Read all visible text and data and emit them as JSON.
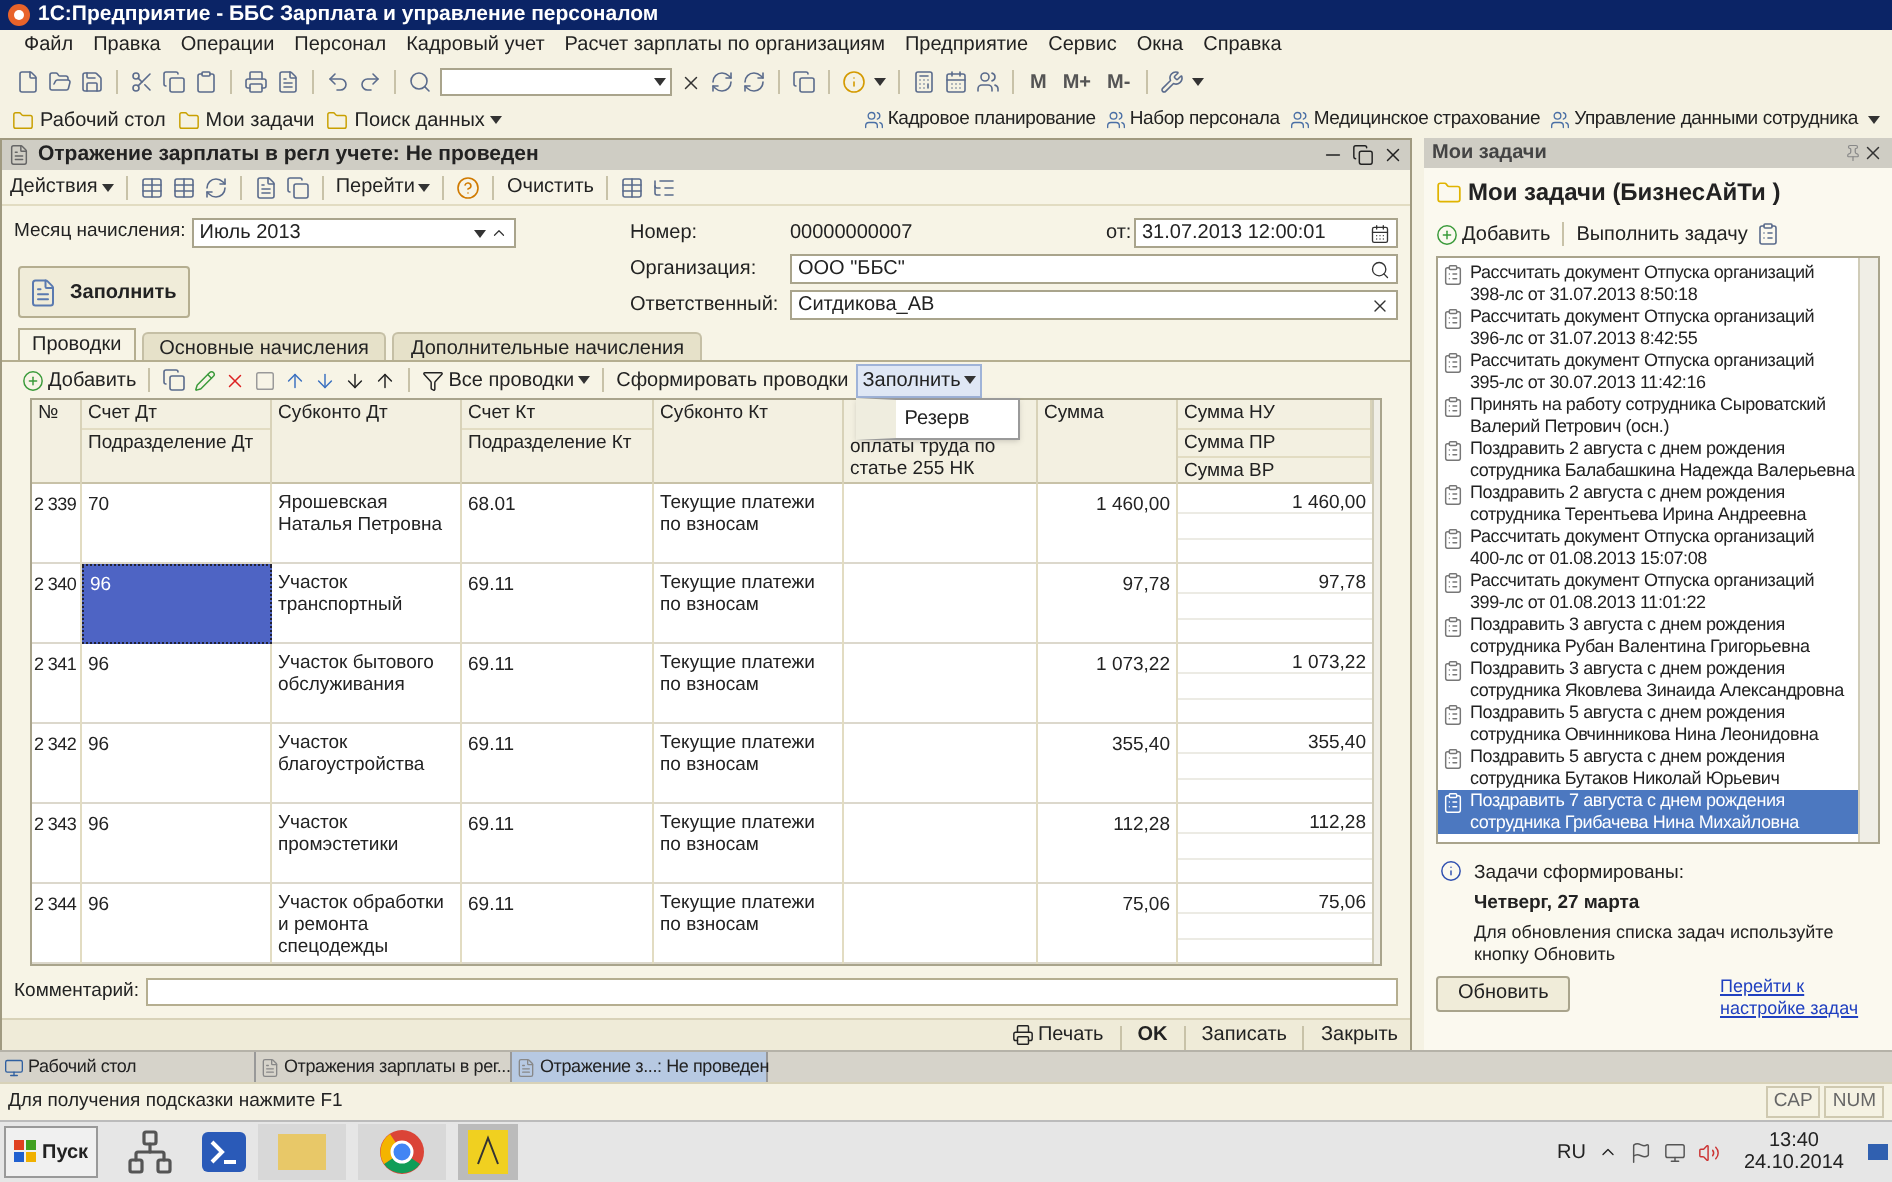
{
  "title_bar": {
    "title": "1С:Предприятие - ББС Зарплата и управление персоналом"
  },
  "menu": [
    "Файл",
    "Правка",
    "Операции",
    "Персонал",
    "Кадровый учет",
    "Расчет зарплаты по организациям",
    "Предприятие",
    "Сервис",
    "Окна",
    "Справка"
  ],
  "toolbar": {
    "memory_buttons": [
      "M",
      "M+",
      "M-"
    ]
  },
  "panel_bar": {
    "left": [
      "Рабочий стол",
      "Мои задачи",
      "Поиск данных"
    ],
    "right": [
      "Кадровое планирование",
      "Набор персонала",
      "Медицинское страхование",
      "Управление данными сотрудника"
    ]
  },
  "document": {
    "title": "Отражение зарплаты в регл учете: Не проведен",
    "toolbar": {
      "actions": "Действия",
      "goto": "Перейти",
      "clear": "Очистить"
    },
    "month_label": "Месяц начисления:",
    "month_value": "Июль 2013",
    "number_label": "Номер:",
    "number_value": "00000000007",
    "date_label": "от:",
    "date_value": "31.07.2013 12:00:01",
    "org_label": "Организация:",
    "org_value": "ООО \"ББС\"",
    "resp_label": "Ответственный:",
    "resp_value": "Ситдикова_АВ",
    "fill_button": "Заполнить",
    "tabs": [
      {
        "label": "Проводки",
        "selected": true
      },
      {
        "label": "Основные начисления",
        "selected": false
      },
      {
        "label": "Дополнительные начисления",
        "selected": false
      }
    ],
    "table_toolbar": {
      "add": "Добавить",
      "all": "Все проводки",
      "form": "Сформировать проводки",
      "fill": "Заполнить",
      "fill_open": true
    },
    "dropdown": {
      "items": [
        "Резерв"
      ]
    },
    "table": {
      "columns": [
        {
          "lines": [
            "№"
          ]
        },
        {
          "lines": [
            "Счет Дт",
            "Подразделение Дт"
          ]
        },
        {
          "lines": [
            "Субконто Дт"
          ]
        },
        {
          "lines": [
            "Счет Кт",
            "Подразделение Кт"
          ]
        },
        {
          "lines": [
            "Субконто Кт"
          ]
        },
        {
          "lines": [
            "оплаты труда по статье 255 НК"
          ]
        },
        {
          "lines": [
            "Сумма"
          ]
        },
        {
          "lines": [
            "Сумма НУ",
            "Сумма ПР",
            "Сумма ВР"
          ]
        }
      ],
      "rows": [
        {
          "no": "2 339",
          "dt": "70",
          "dt_selected": false,
          "sub_dt": "Ярошевская Наталья Петровна",
          "kt": "68.01",
          "sub_kt": "Текущие платежи по взносам",
          "summa": "1 460,00",
          "summa_nu": "1 460,00"
        },
        {
          "no": "2 340",
          "dt": "96",
          "dt_selected": true,
          "sub_dt": "Участок транспортный",
          "kt": "69.11",
          "sub_kt": "Текущие платежи по взносам",
          "summa": "97,78",
          "summa_nu": "97,78"
        },
        {
          "no": "2 341",
          "dt": "96",
          "dt_selected": false,
          "sub_dt": "Участок бытового обслуживания",
          "kt": "69.11",
          "sub_kt": "Текущие платежи по взносам",
          "summa": "1 073,22",
          "summa_nu": "1 073,22"
        },
        {
          "no": "2 342",
          "dt": "96",
          "dt_selected": false,
          "sub_dt": "Участок благоустройства",
          "kt": "69.11",
          "sub_kt": "Текущие платежи по взносам",
          "summa": "355,40",
          "summa_nu": "355,40"
        },
        {
          "no": "2 343",
          "dt": "96",
          "dt_selected": false,
          "sub_dt": "Участок промэстетики",
          "kt": "69.11",
          "sub_kt": "Текущие платежи по взносам",
          "summa": "112,28",
          "summa_nu": "112,28"
        },
        {
          "no": "2 344",
          "dt": "96",
          "dt_selected": false,
          "sub_dt": "Участок обработки и ремонта спецодежды",
          "kt": "69.11",
          "sub_kt": "Текущие платежи по взносам",
          "summa": "75,06",
          "summa_nu": "75,06"
        }
      ]
    },
    "comment_label": "Комментарий:",
    "buttons": {
      "print": "Печать",
      "ok": "OK",
      "save": "Записать",
      "close": "Закрыть"
    }
  },
  "tasks_panel": {
    "title": "Мои задачи",
    "heading": "Мои задачи (БизнесАйТи )",
    "add": "Добавить",
    "execute": "Выполнить задачу",
    "tasks": [
      {
        "lines": [
          "Рассчитать документ Отпуска организаций",
          "398-лс от 31.07.2013 8:50:18"
        ],
        "selected": false
      },
      {
        "lines": [
          "Рассчитать документ Отпуска организаций",
          "396-лс от 31.07.2013 8:42:55"
        ],
        "selected": false
      },
      {
        "lines": [
          "Рассчитать документ Отпуска организаций",
          "395-лс от 30.07.2013 11:42:16"
        ],
        "selected": false
      },
      {
        "lines": [
          "Принять на работу сотрудника Сыроватский",
          "Валерий Петрович  (осн.)"
        ],
        "selected": false
      },
      {
        "lines": [
          "Поздравить 2 августа с днем рождения",
          "сотрудника Балабашкина Надежда Валерьевна"
        ],
        "selected": false
      },
      {
        "lines": [
          "Поздравить 2 августа с днем рождения",
          "сотрудника Терентьева Ирина Андреевна"
        ],
        "selected": false
      },
      {
        "lines": [
          "Рассчитать документ Отпуска организаций",
          "400-лс от 01.08.2013 15:07:08"
        ],
        "selected": false
      },
      {
        "lines": [
          "Рассчитать документ Отпуска организаций",
          "399-лс от 01.08.2013 11:01:22"
        ],
        "selected": false
      },
      {
        "lines": [
          "Поздравить 3 августа с днем рождения",
          "сотрудника Рубан Валентина Григорьевна"
        ],
        "selected": false
      },
      {
        "lines": [
          "Поздравить 3 августа с днем рождения",
          "сотрудника Яковлева Зинаида Александровна"
        ],
        "selected": false
      },
      {
        "lines": [
          "Поздравить 5 августа с днем рождения",
          "сотрудника Овчинникова Нина Леонидовна"
        ],
        "selected": false
      },
      {
        "lines": [
          "Поздравить 5 августа с днем рождения",
          "сотрудника Бутаков Николай Юрьевич"
        ],
        "selected": false
      },
      {
        "lines": [
          "Поздравить 7 августа с днем рождения",
          "сотрудника Грибачева Нина Михайловна"
        ],
        "selected": true
      }
    ],
    "info_title": "Задачи сформированы:",
    "info_date": "Четверг, 27 марта",
    "info_text": "Для обновления списка задач используйте кнопку Обновить",
    "refresh": "Обновить",
    "settings_link": "Перейти к настройке задач"
  },
  "window_tabs": [
    {
      "label": "Рабочий стол",
      "selected": false
    },
    {
      "label": "Отражения зарплаты в рег...",
      "selected": false
    },
    {
      "label": "Отражение з...: Не проведен",
      "selected": true
    }
  ],
  "status_bar": {
    "hint": "Для получения подсказки нажмите F1",
    "indicators": [
      "CAP",
      "NUM"
    ]
  },
  "taskbar": {
    "start": "Пуск",
    "language": "RU",
    "time": "13:40",
    "date": "24.10.2014"
  }
}
